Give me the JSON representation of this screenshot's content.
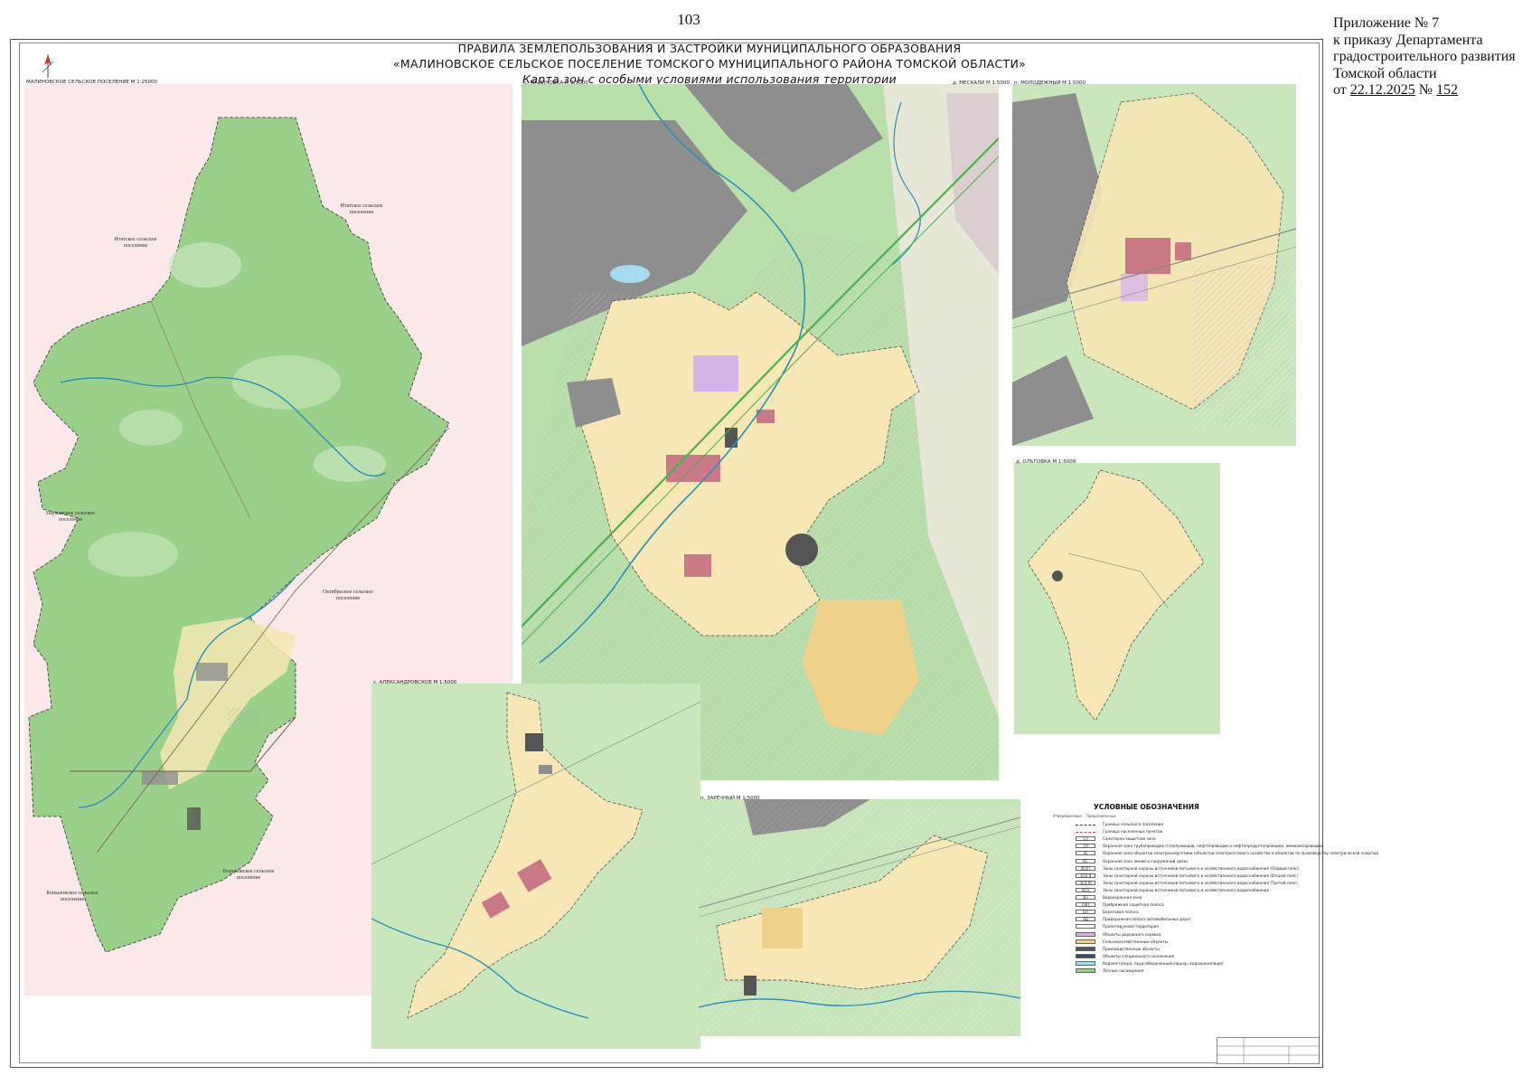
{
  "page_number": "103",
  "appendix": {
    "line1": "Приложение № 7",
    "line2": "к приказу Департамента",
    "line3": "градостроительного развития",
    "line4": "Томской области",
    "line5_prefix": "от ",
    "date": "22.12.2025",
    "number_prefix": "№ ",
    "number": "152"
  },
  "title": {
    "line1": "ПРАВИЛА ЗЕМЛЕПОЛЬЗОВАНИЯ И ЗАСТРОЙКИ МУНИЦИПАЛЬНОГО ОБРАЗОВАНИЯ",
    "line2": "«МАЛИНОВСКОЕ СЕЛЬСКОЕ ПОСЕЛЕНИЕ ТОМСКОГО МУНИЦИПАЛЬНОГО РАЙОНА ТОМСКОЙ ОБЛАСТИ»",
    "line3": "Карта зон с особыми условиями использования территории"
  },
  "insets": {
    "main": "МАЛИНОВСКОЕ СЕЛЬСКОЕ ПОСЕЛЕНИЕ  М 1:25000",
    "malinovka": "с. МАЛИНОВКА  М 1:5000",
    "meskali": "д. МЕСКАЛИ  М 1:5000",
    "molodezhny": "п. МОЛОДЕЖНЫЙ  М 1:5000",
    "olgovka": "д. ОЛЬГОВКА  М 1:5000",
    "aleksandrovskoe": "с. АЛЕКСАНДРОВСКОЕ  М 1:5000",
    "zarechny": "п. ЗАРЕЧНЫЙ  М 1:5000"
  },
  "map_labels": {
    "itatka_top": "Итатское сельское\nпоселение",
    "itatka_left": "Итатское сельское\nпоселение",
    "naumovka": "Наумовское сельское\nпоселение",
    "oktyabrskoe": "Октябрьское сельское\nпоселение",
    "voronovo": "Вороновское сельское\nпоселение",
    "kopylovo": "Копыловское сельское\nпоселение"
  },
  "legend": {
    "title": "УСЛОВНЫЕ ОБОЗНАЧЕНИЯ",
    "col1": "Утвержденные",
    "col2": "Предложенные",
    "items": [
      {
        "code": "",
        "label": "Граница сельского поселения"
      },
      {
        "code": "",
        "label": "Граница населенных пунктов"
      },
      {
        "code": "СЗ",
        "label": "Санитарно-защитная зона"
      },
      {
        "code": "ТП",
        "label": "Охранная зона трубопроводов (газопроводов, нефтепроводов и нефтепродуктопроводов, аммиакопроводов)"
      },
      {
        "code": "ЭС",
        "label": "Охранная зона объектов электроэнергетики (объектов электросетевого хозяйства и объектов по производству электрической энергии)"
      },
      {
        "code": "КС",
        "label": "Охранная зона линий и сооружений связи"
      },
      {
        "code": "ЗСО I",
        "label": "Зоны санитарной охраны источников питьевого и хозяйственного водоснабжения (Первый пояс)"
      },
      {
        "code": "ЗСО II",
        "label": "Зоны санитарной охраны источников питьевого и хозяйственного водоснабжения (Второй пояс)"
      },
      {
        "code": "ЗСО III",
        "label": "Зоны санитарной охраны источников питьевого и хозяйственного водоснабжения (Третий пояс)"
      },
      {
        "code": "ЗСО",
        "label": "Зоны санитарной охраны источников питьевого и хозяйственного водоснабжения"
      },
      {
        "code": "ВЗ",
        "label": "Водоохранная зона"
      },
      {
        "code": "ПЗП",
        "label": "Прибрежная защитная полоса"
      },
      {
        "code": "БП",
        "label": "Береговая полоса"
      },
      {
        "code": "АД",
        "label": "Придорожная полоса автомобильных дорог"
      },
      {
        "code": "",
        "label": "Проектируемая территория"
      },
      {
        "code": "",
        "label": "Объекты дорожного сервиса"
      },
      {
        "code": "",
        "label": "Сельскохозяйственные объекты"
      },
      {
        "code": "",
        "label": "Производственные объекты"
      },
      {
        "code": "",
        "label": "Объекты специального назначения"
      },
      {
        "code": "",
        "label": "Водоем (озеро, пруд обводненный карьер, водохранилище)"
      },
      {
        "code": "",
        "label": "Лесные насаждения"
      }
    ]
  },
  "colors": {
    "forest": "#9bd08a",
    "forest_light": "#c9e6bd",
    "outside": "#fbe9ea",
    "settlement": "#f6e7b4",
    "gray_zone": "#8e8e8e",
    "industrial": "#c97a86",
    "purple": "#d4b5e8",
    "water": "#a6dbef",
    "river": "#2f8fb5",
    "boundary": "#333333"
  }
}
